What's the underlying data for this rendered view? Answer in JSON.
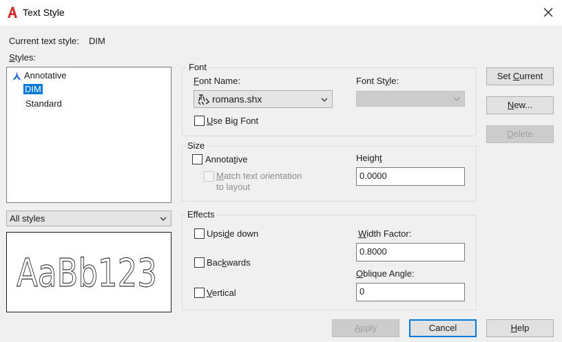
{
  "window": {
    "title": "Text Style",
    "icon": "autocad-a-icon",
    "close_icon": "close-icon"
  },
  "current_style": {
    "label": "Current text style:",
    "value": "DIM"
  },
  "styles": {
    "label": "Styles:",
    "items": [
      {
        "label": "Annotative",
        "icon": "annotative-icon"
      },
      {
        "label": "DIM",
        "selected": true
      },
      {
        "label": "Standard"
      }
    ],
    "filter": {
      "value": "All styles"
    }
  },
  "preview": {
    "text": "AaBb123"
  },
  "font": {
    "group_label": "Font",
    "name_label": "Font Name:",
    "name_value": "romans.shx",
    "name_icon": "shx-font-icon",
    "style_label": "Font Style:",
    "style_value": "",
    "big_font_label": "Use Big Font",
    "big_font_checked": false
  },
  "size": {
    "group_label": "Size",
    "annotative_label": "Annotative",
    "annotative_checked": false,
    "match_label_1": "Match text orientation",
    "match_label_2": "to layout",
    "height_label": "Height",
    "height_value": "0.0000"
  },
  "effects": {
    "group_label": "Effects",
    "upside_down_label": "Upside down",
    "backwards_label": "Backwards",
    "vertical_label": "Vertical",
    "width_factor_label": "Width Factor:",
    "width_factor_value": "0.8000",
    "oblique_label": "Oblique Angle:",
    "oblique_value": "0"
  },
  "buttons": {
    "set_current": "Set Current",
    "new": "New...",
    "delete": "Delete",
    "apply": "Apply",
    "cancel": "Cancel",
    "help": "Help"
  },
  "colors": {
    "accent": "#0078d7",
    "dialog_bg": "#f0f0f0",
    "icon_red": "#d0312d",
    "icon_blue": "#2a6cc7"
  }
}
